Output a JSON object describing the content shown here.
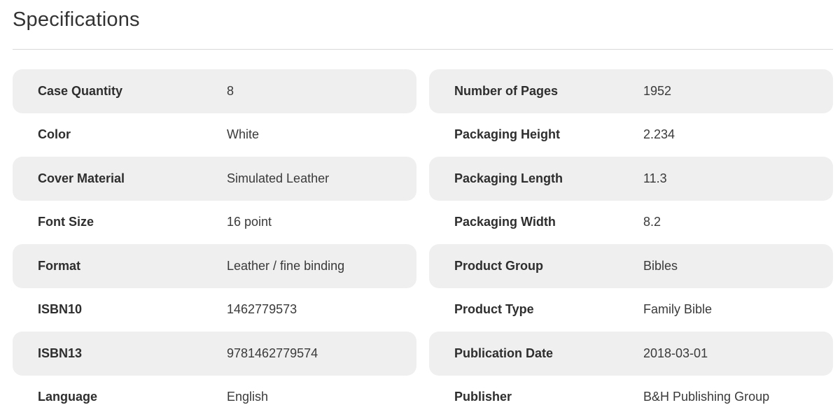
{
  "section": {
    "title": "Specifications"
  },
  "specs": {
    "left": [
      {
        "label": "Case Quantity",
        "value": "8"
      },
      {
        "label": "Color",
        "value": "White"
      },
      {
        "label": "Cover Material",
        "value": "Simulated Leather"
      },
      {
        "label": "Font Size",
        "value": "16 point"
      },
      {
        "label": "Format",
        "value": "Leather / fine binding"
      },
      {
        "label": "ISBN10",
        "value": "1462779573"
      },
      {
        "label": "ISBN13",
        "value": "9781462779574"
      },
      {
        "label": "Language",
        "value": "English"
      }
    ],
    "right": [
      {
        "label": "Number of Pages",
        "value": "1952"
      },
      {
        "label": "Packaging Height",
        "value": "2.234"
      },
      {
        "label": "Packaging Length",
        "value": "11.3"
      },
      {
        "label": "Packaging Width",
        "value": "8.2"
      },
      {
        "label": "Product Group",
        "value": "Bibles"
      },
      {
        "label": "Product Type",
        "value": "Family Bible"
      },
      {
        "label": "Publication Date",
        "value": "2018-03-01"
      },
      {
        "label": "Publisher",
        "value": "B&H Publishing Group"
      }
    ]
  },
  "colors": {
    "row_shade": "#efefef",
    "divider": "#d9d9d9",
    "text": "#2e2e2e"
  }
}
